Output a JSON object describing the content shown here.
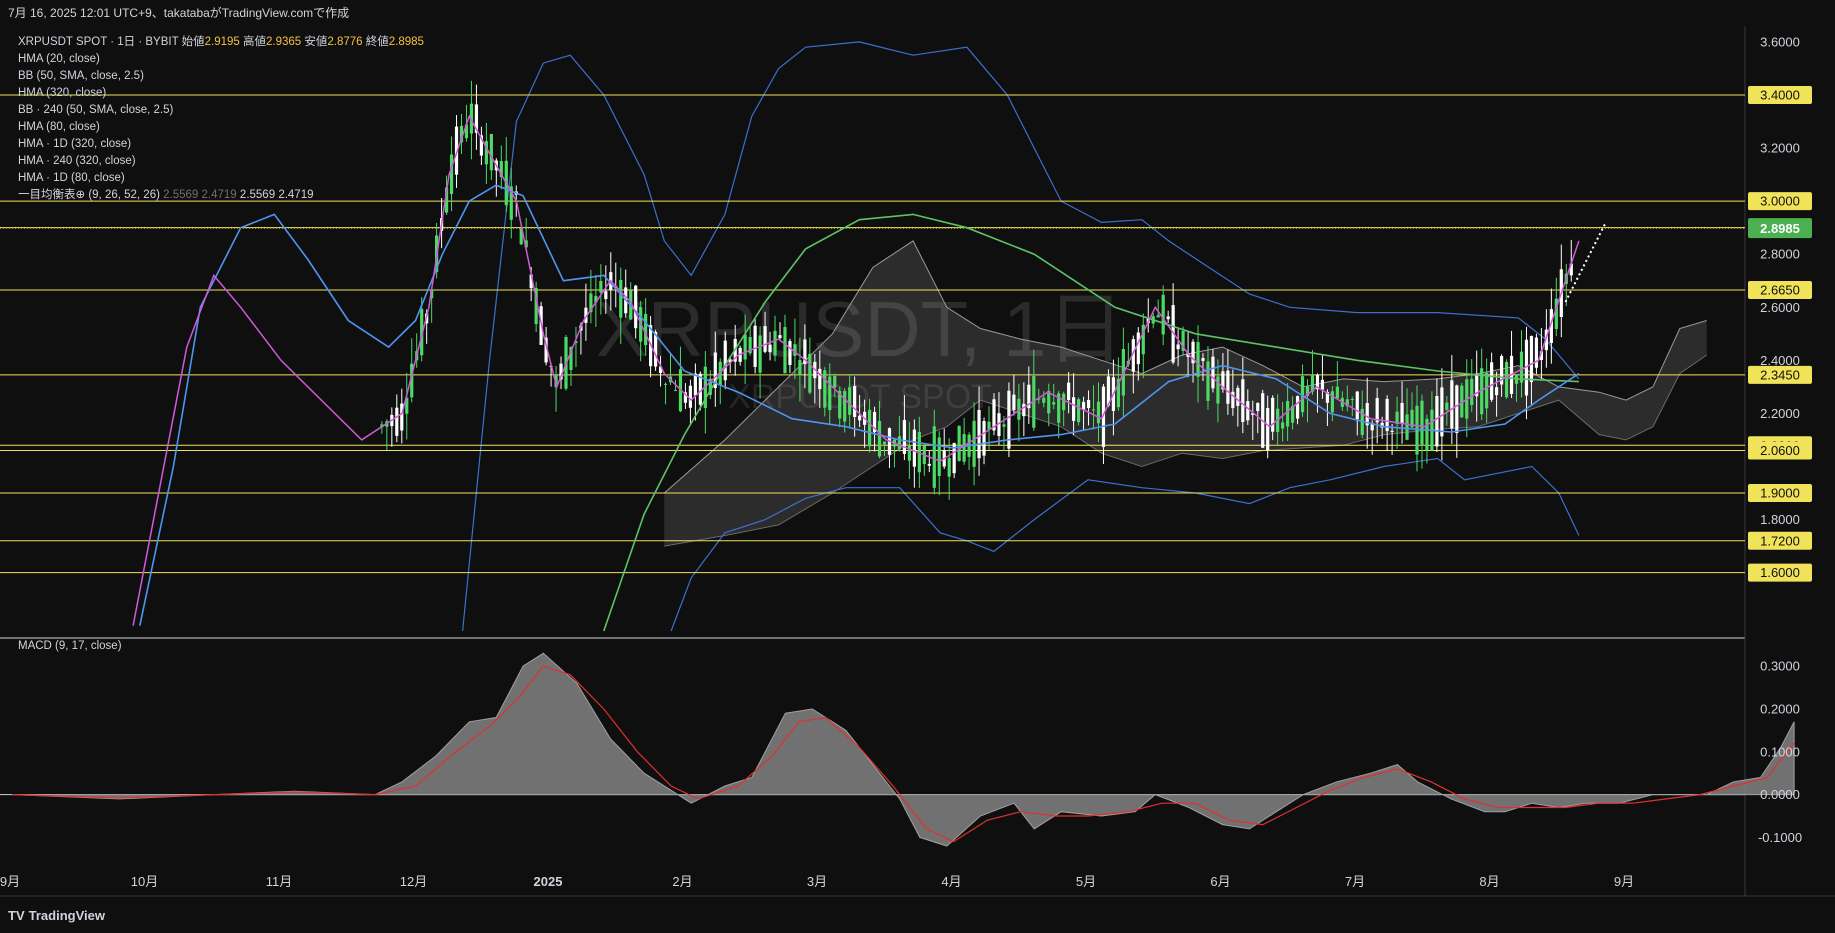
{
  "header": {
    "caption": "7月 16, 2025 12:01 UTC+9、takatabaがTradingView.comで作成"
  },
  "legend": {
    "symbol": "XRPUSDT SPOT · 1日 · BYBIT",
    "open_label": "始値",
    "open": "2.9195",
    "high_label": "高値",
    "high": "2.9365",
    "low_label": "安値",
    "low": "2.8776",
    "close_label": "終値",
    "close": "2.8985",
    "indicators": [
      "HMA (20, close)",
      "BB (50, SMA, close, 2.5)",
      "HMA (320, close)",
      "BB · 240 (50, SMA, close, 2.5)",
      "HMA (80, close)",
      "HMA · 1D (320, close)",
      "HMA · 240 (320, close)",
      "HMA · 1D (80, close)"
    ],
    "ichimoku_label": "一目均衡表⊕ (9, 26, 52, 26)",
    "ichimoku_values": [
      "2.5569",
      "2.4719",
      "2.5569",
      "2.4719"
    ]
  },
  "watermark": {
    "main": "XRPUSDT, 1日",
    "sub": "XRPUSDT SPOT"
  },
  "macd_label": "MACD (9, 17, close)",
  "footer": {
    "logo": "TradingView"
  },
  "colors": {
    "bg": "#0f0f0f",
    "up": "#4cd964",
    "down": "#ffffff",
    "hma20": "#d05ad8",
    "hma80": "#4f94ee",
    "hma320": "#5cc466",
    "bb": "#3d6fcf",
    "level": "#f0e35a",
    "current": "#4caf50",
    "macd_hist": "#8a8a8a",
    "macd_signal": "#e03030"
  },
  "chart_data": {
    "type": "line",
    "price_axis": {
      "ticks": [
        "3.6000",
        "3.2000",
        "2.8000",
        "2.6000",
        "2.4000",
        "2.2000",
        "1.8000"
      ],
      "range": [
        1.38,
        3.66
      ]
    },
    "time_axis": {
      "ticks": [
        "9月",
        "10月",
        "11月",
        "12月",
        "2025",
        "2月",
        "3月",
        "4月",
        "5月",
        "6月",
        "7月",
        "8月",
        "9月"
      ]
    },
    "levels": [
      "3.4000",
      "3.0000",
      "2.9000",
      "2.6650",
      "2.3450",
      "2.0800",
      "2.0600",
      "1.9000",
      "1.7200",
      "1.6000"
    ],
    "current_price": "2.8985",
    "hma20": [
      [
        0.9,
        1.4
      ],
      [
        1.3,
        2.45
      ],
      [
        1.5,
        2.72
      ],
      [
        1.7,
        2.6
      ],
      [
        2.0,
        2.4
      ],
      [
        2.3,
        2.25
      ],
      [
        2.6,
        2.1
      ],
      [
        2.9,
        2.2
      ],
      [
        3.1,
        2.6
      ],
      [
        3.25,
        3.1
      ],
      [
        3.4,
        3.32
      ],
      [
        3.55,
        3.18
      ],
      [
        3.75,
        3.0
      ],
      [
        3.95,
        2.5
      ],
      [
        4.05,
        2.3
      ],
      [
        4.25,
        2.55
      ],
      [
        4.45,
        2.7
      ],
      [
        4.6,
        2.62
      ],
      [
        4.85,
        2.35
      ],
      [
        5.05,
        2.25
      ],
      [
        5.4,
        2.42
      ],
      [
        5.7,
        2.48
      ],
      [
        5.9,
        2.4
      ],
      [
        6.2,
        2.25
      ],
      [
        6.5,
        2.1
      ],
      [
        6.9,
        2.02
      ],
      [
        7.3,
        2.15
      ],
      [
        7.7,
        2.28
      ],
      [
        8.1,
        2.18
      ],
      [
        8.5,
        2.6
      ],
      [
        8.75,
        2.42
      ],
      [
        9.0,
        2.3
      ],
      [
        9.35,
        2.15
      ],
      [
        9.7,
        2.3
      ],
      [
        10.1,
        2.18
      ],
      [
        10.5,
        2.15
      ],
      [
        10.9,
        2.28
      ],
      [
        11.35,
        2.4
      ],
      [
        11.65,
        2.85
      ]
    ],
    "hma80": [
      [
        0.95,
        1.4
      ],
      [
        1.2,
        2.0
      ],
      [
        1.4,
        2.6
      ],
      [
        1.7,
        2.9
      ],
      [
        1.95,
        2.95
      ],
      [
        2.2,
        2.78
      ],
      [
        2.5,
        2.55
      ],
      [
        2.8,
        2.45
      ],
      [
        3.0,
        2.55
      ],
      [
        3.2,
        2.8
      ],
      [
        3.4,
        3.0
      ],
      [
        3.6,
        3.06
      ],
      [
        3.8,
        3.02
      ],
      [
        4.1,
        2.7
      ],
      [
        4.4,
        2.72
      ],
      [
        4.7,
        2.55
      ],
      [
        5.0,
        2.36
      ],
      [
        5.4,
        2.28
      ],
      [
        5.8,
        2.18
      ],
      [
        6.2,
        2.15
      ],
      [
        6.6,
        2.1
      ],
      [
        7.0,
        2.07
      ],
      [
        7.4,
        2.1
      ],
      [
        7.8,
        2.12
      ],
      [
        8.2,
        2.16
      ],
      [
        8.6,
        2.32
      ],
      [
        9.0,
        2.38
      ],
      [
        9.4,
        2.33
      ],
      [
        9.8,
        2.2
      ],
      [
        10.2,
        2.15
      ],
      [
        10.7,
        2.13
      ],
      [
        11.1,
        2.16
      ],
      [
        11.35,
        2.25
      ],
      [
        11.65,
        2.35
      ]
    ],
    "hma320": [
      [
        4.4,
        1.38
      ],
      [
        4.7,
        1.82
      ],
      [
        5.0,
        2.12
      ],
      [
        5.3,
        2.38
      ],
      [
        5.6,
        2.62
      ],
      [
        5.9,
        2.82
      ],
      [
        6.3,
        2.93
      ],
      [
        6.7,
        2.95
      ],
      [
        7.1,
        2.9
      ],
      [
        7.6,
        2.8
      ],
      [
        8.2,
        2.6
      ],
      [
        8.8,
        2.5
      ],
      [
        9.4,
        2.45
      ],
      [
        10.0,
        2.4
      ],
      [
        10.6,
        2.36
      ],
      [
        11.2,
        2.33
      ],
      [
        11.65,
        2.32
      ]
    ],
    "bb_upper": [
      [
        3.35,
        1.38
      ],
      [
        3.55,
        2.4
      ],
      [
        3.75,
        3.3
      ],
      [
        3.95,
        3.52
      ],
      [
        4.15,
        3.55
      ],
      [
        4.4,
        3.4
      ],
      [
        4.7,
        3.1
      ],
      [
        4.85,
        2.85
      ],
      [
        5.05,
        2.72
      ],
      [
        5.3,
        2.95
      ],
      [
        5.5,
        3.32
      ],
      [
        5.7,
        3.5
      ],
      [
        5.9,
        3.58
      ],
      [
        6.3,
        3.6
      ],
      [
        6.7,
        3.55
      ],
      [
        7.1,
        3.58
      ],
      [
        7.4,
        3.4
      ],
      [
        7.6,
        3.2
      ],
      [
        7.8,
        3.0
      ],
      [
        8.1,
        2.92
      ],
      [
        8.4,
        2.93
      ],
      [
        8.6,
        2.85
      ],
      [
        8.9,
        2.75
      ],
      [
        9.2,
        2.65
      ],
      [
        9.5,
        2.6
      ],
      [
        10.0,
        2.58
      ],
      [
        10.6,
        2.58
      ],
      [
        11.2,
        2.56
      ],
      [
        11.4,
        2.48
      ],
      [
        11.65,
        2.33
      ]
    ],
    "bb_lower": [
      [
        4.9,
        1.38
      ],
      [
        5.05,
        1.58
      ],
      [
        5.3,
        1.75
      ],
      [
        5.6,
        1.8
      ],
      [
        5.9,
        1.88
      ],
      [
        6.2,
        1.92
      ],
      [
        6.6,
        1.92
      ],
      [
        6.9,
        1.75
      ],
      [
        7.1,
        1.72
      ],
      [
        7.3,
        1.68
      ],
      [
        7.6,
        1.8
      ],
      [
        8.0,
        1.95
      ],
      [
        8.4,
        1.92
      ],
      [
        8.8,
        1.9
      ],
      [
        9.2,
        1.86
      ],
      [
        9.5,
        1.92
      ],
      [
        9.8,
        1.95
      ],
      [
        10.2,
        2.0
      ],
      [
        10.6,
        2.03
      ],
      [
        10.8,
        1.95
      ],
      [
        11.1,
        1.98
      ],
      [
        11.3,
        2.0
      ],
      [
        11.5,
        1.9
      ],
      [
        11.65,
        1.74
      ]
    ],
    "cloud_upper": [
      [
        4.85,
        1.9
      ],
      [
        5.3,
        2.1
      ],
      [
        5.7,
        2.3
      ],
      [
        6.1,
        2.5
      ],
      [
        6.4,
        2.75
      ],
      [
        6.7,
        2.85
      ],
      [
        6.95,
        2.6
      ],
      [
        7.2,
        2.52
      ],
      [
        7.5,
        2.48
      ],
      [
        7.8,
        2.45
      ],
      [
        8.1,
        2.4
      ],
      [
        8.4,
        2.35
      ],
      [
        8.7,
        2.42
      ],
      [
        9.0,
        2.45
      ],
      [
        9.3,
        2.38
      ],
      [
        9.6,
        2.3
      ],
      [
        9.9,
        2.33
      ],
      [
        10.2,
        2.32
      ],
      [
        10.6,
        2.33
      ],
      [
        10.9,
        2.35
      ],
      [
        11.2,
        2.38
      ],
      [
        11.5,
        2.3
      ],
      [
        11.8,
        2.28
      ],
      [
        12.0,
        2.25
      ],
      [
        12.2,
        2.3
      ],
      [
        12.4,
        2.52
      ],
      [
        12.6,
        2.55
      ]
    ],
    "cloud_lower": [
      [
        4.85,
        1.7
      ],
      [
        5.3,
        1.74
      ],
      [
        5.7,
        1.78
      ],
      [
        6.1,
        1.9
      ],
      [
        6.4,
        2.0
      ],
      [
        6.7,
        2.1
      ],
      [
        6.95,
        2.15
      ],
      [
        7.2,
        2.25
      ],
      [
        7.5,
        2.2
      ],
      [
        7.8,
        2.15
      ],
      [
        8.1,
        2.05
      ],
      [
        8.4,
        2.0
      ],
      [
        8.7,
        2.05
      ],
      [
        9.0,
        2.03
      ],
      [
        9.3,
        2.06
      ],
      [
        9.6,
        2.07
      ],
      [
        9.9,
        2.08
      ],
      [
        10.2,
        2.12
      ],
      [
        10.6,
        2.14
      ],
      [
        10.9,
        2.15
      ],
      [
        11.2,
        2.2
      ],
      [
        11.5,
        2.25
      ],
      [
        11.8,
        2.12
      ],
      [
        12.0,
        2.1
      ],
      [
        12.2,
        2.15
      ],
      [
        12.4,
        2.35
      ],
      [
        12.6,
        2.42
      ]
    ],
    "macd_hist": [
      [
        0.0,
        0.0
      ],
      [
        0.8,
        -0.01
      ],
      [
        1.5,
        0.0
      ],
      [
        2.1,
        0.008
      ],
      [
        2.7,
        0.0
      ],
      [
        2.9,
        0.03
      ],
      [
        3.15,
        0.09
      ],
      [
        3.4,
        0.17
      ],
      [
        3.6,
        0.18
      ],
      [
        3.8,
        0.3
      ],
      [
        3.95,
        0.33
      ],
      [
        4.2,
        0.26
      ],
      [
        4.45,
        0.13
      ],
      [
        4.7,
        0.05
      ],
      [
        4.95,
        0.0
      ],
      [
        5.05,
        -0.02
      ],
      [
        5.3,
        0.02
      ],
      [
        5.5,
        0.04
      ],
      [
        5.75,
        0.19
      ],
      [
        5.95,
        0.2
      ],
      [
        6.2,
        0.15
      ],
      [
        6.45,
        0.05
      ],
      [
        6.6,
        -0.01
      ],
      [
        6.75,
        -0.1
      ],
      [
        6.95,
        -0.12
      ],
      [
        7.2,
        -0.05
      ],
      [
        7.45,
        -0.02
      ],
      [
        7.6,
        -0.08
      ],
      [
        7.8,
        -0.04
      ],
      [
        8.1,
        -0.05
      ],
      [
        8.35,
        -0.04
      ],
      [
        8.5,
        0.0
      ],
      [
        8.75,
        -0.03
      ],
      [
        9.0,
        -0.07
      ],
      [
        9.2,
        -0.08
      ],
      [
        9.4,
        -0.04
      ],
      [
        9.6,
        0.0
      ],
      [
        9.85,
        0.03
      ],
      [
        10.1,
        0.05
      ],
      [
        10.3,
        0.07
      ],
      [
        10.45,
        0.03
      ],
      [
        10.7,
        -0.01
      ],
      [
        10.95,
        -0.04
      ],
      [
        11.1,
        -0.04
      ],
      [
        11.3,
        -0.02
      ],
      [
        11.5,
        -0.03
      ],
      [
        11.7,
        -0.02
      ],
      [
        11.95,
        -0.02
      ],
      [
        12.2,
        0.0
      ],
      [
        12.4,
        0.0
      ],
      [
        12.6,
        0.0
      ],
      [
        12.8,
        0.03
      ],
      [
        13.0,
        0.04
      ],
      [
        13.15,
        0.11
      ],
      [
        13.25,
        0.17
      ]
    ],
    "macd_signal": [
      [
        0.0,
        0.0
      ],
      [
        0.8,
        -0.008
      ],
      [
        1.5,
        0.0
      ],
      [
        2.1,
        0.006
      ],
      [
        2.7,
        0.0
      ],
      [
        3.0,
        0.02
      ],
      [
        3.3,
        0.1
      ],
      [
        3.55,
        0.16
      ],
      [
        3.75,
        0.22
      ],
      [
        3.95,
        0.3
      ],
      [
        4.15,
        0.28
      ],
      [
        4.4,
        0.2
      ],
      [
        4.65,
        0.1
      ],
      [
        4.9,
        0.02
      ],
      [
        5.1,
        -0.01
      ],
      [
        5.4,
        0.02
      ],
      [
        5.65,
        0.09
      ],
      [
        5.85,
        0.17
      ],
      [
        6.05,
        0.18
      ],
      [
        6.3,
        0.11
      ],
      [
        6.55,
        0.02
      ],
      [
        6.8,
        -0.08
      ],
      [
        7.0,
        -0.11
      ],
      [
        7.25,
        -0.06
      ],
      [
        7.5,
        -0.04
      ],
      [
        7.75,
        -0.05
      ],
      [
        8.0,
        -0.05
      ],
      [
        8.3,
        -0.04
      ],
      [
        8.55,
        -0.02
      ],
      [
        8.8,
        -0.02
      ],
      [
        9.05,
        -0.06
      ],
      [
        9.3,
        -0.07
      ],
      [
        9.55,
        -0.03
      ],
      [
        9.8,
        0.01
      ],
      [
        10.05,
        0.04
      ],
      [
        10.3,
        0.06
      ],
      [
        10.55,
        0.03
      ],
      [
        10.8,
        -0.01
      ],
      [
        11.05,
        -0.03
      ],
      [
        11.3,
        -0.03
      ],
      [
        11.55,
        -0.03
      ],
      [
        11.8,
        -0.02
      ],
      [
        12.05,
        -0.02
      ],
      [
        12.3,
        -0.01
      ],
      [
        12.55,
        0.0
      ],
      [
        12.8,
        0.02
      ],
      [
        13.05,
        0.04
      ],
      [
        13.25,
        0.12
      ]
    ],
    "macd_axis": {
      "ticks": [
        "0.3000",
        "0.2000",
        "0.1000",
        "0.0000",
        "-0.1000"
      ],
      "range": [
        -0.155,
        0.375
      ]
    }
  }
}
